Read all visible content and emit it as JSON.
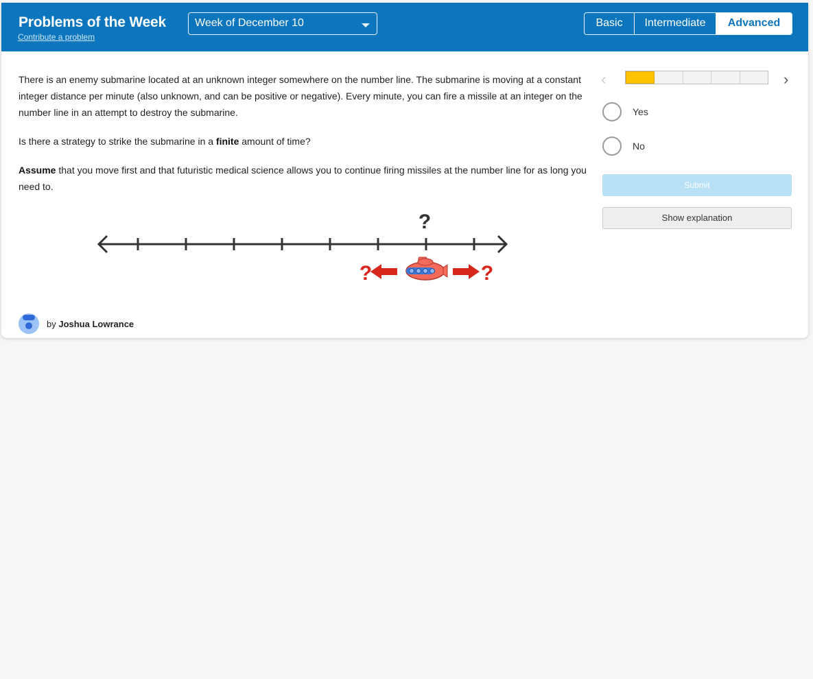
{
  "header": {
    "title": "Problems of the Week",
    "contribute_link": "Contribute a problem",
    "week_select": {
      "value": "Week of December 10"
    },
    "levels": [
      {
        "label": "Basic",
        "active": false
      },
      {
        "label": "Intermediate",
        "active": false
      },
      {
        "label": "Advanced",
        "active": true
      }
    ],
    "colors": {
      "header_bg": "#0b75bd",
      "active_level_text": "#0b75bd"
    }
  },
  "problem": {
    "p1": "There is an enemy submarine located at an unknown integer somewhere on the number line. The submarine is moving at a constant integer distance per minute (also unknown, and can be positive or negative). Every minute, you can fire a missile at an integer on the number line in an attempt to destroy the submarine.",
    "p2_before": "Is there a strategy to strike the submarine in a ",
    "p2_bold": "finite",
    "p2_after": " amount of time?",
    "p3_bold": "Assume",
    "p3_after": " that you move first and that futuristic medical science allows you to continue firing missiles at the number line for as long you need to."
  },
  "diagram": {
    "top_question": "?",
    "left_question": "?",
    "right_question": "?",
    "tick_count": 8,
    "submarine_tick": 7,
    "colors": {
      "arrow_red": "#d7261c",
      "sub_fill": "#f46a5a",
      "line": "#333333"
    }
  },
  "author": {
    "prefix": "by ",
    "name": "Joshua Lowrance"
  },
  "progress": {
    "total": 5,
    "completed": 1,
    "prev_icon": "chevron-left",
    "next_icon": "chevron-right"
  },
  "answers": [
    {
      "label": "Yes",
      "selected": false
    },
    {
      "label": "No",
      "selected": false
    }
  ],
  "actions": {
    "submit_label": "Submit",
    "explain_label": "Show explanation"
  }
}
